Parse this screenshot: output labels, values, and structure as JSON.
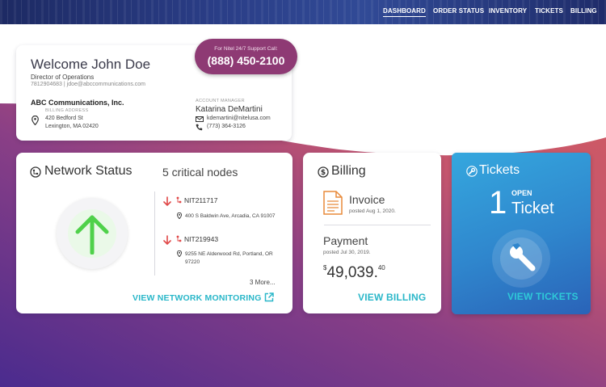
{
  "nav": {
    "items": [
      "DASHBOARD",
      "ORDER STATUS",
      "INVENTORY",
      "TICKETS",
      "BILLING"
    ]
  },
  "welcome": {
    "greeting": "Welcome",
    "name": "John Doe",
    "title": "Director of Operations",
    "contact": "7812904683 | jdoe@abccommunications.com",
    "company": "ABC Communications, Inc.",
    "billing_label": "BILLING ADDRESS",
    "address_line1": "420 Bedford St",
    "address_line2": "Lexington, MA 02420",
    "manager_label": "ACCOUNT MANAGER",
    "manager_name": "Katarina DeMartini",
    "manager_email": "kdemartini@nitelusa.com",
    "manager_phone": "(773) 364-3126"
  },
  "support": {
    "label": "For Nitel 24/7 Support Call:",
    "phone": "(888) 450-2100"
  },
  "network": {
    "title": "Network Status",
    "critical": "5 critical nodes",
    "nodes": [
      {
        "id": "NIT211717",
        "address": "400 S Baldwin Ave, Arcadia, CA 91007"
      },
      {
        "id": "NIT219943",
        "address": "9255 NE Alderwood Rd, Portland, OR 97220"
      }
    ],
    "more": "3 More...",
    "link": "VIEW NETWORK MONITORING"
  },
  "billing": {
    "title": "Billing",
    "invoice_label": "Invoice",
    "invoice_posted": "posted Aug 1, 2020.",
    "payment_label": "Payment",
    "payment_posted": "posted Jul 30, 2019.",
    "amount_currency": "$",
    "amount_main": "49,039.",
    "amount_cents": "40",
    "link": "VIEW BILLING"
  },
  "tickets": {
    "title": "Tickets",
    "count": "1",
    "status": "OPEN",
    "noun": "Ticket",
    "link": "VIEW TICKETS"
  },
  "colors": {
    "accent": "#2ab7c9",
    "support_pill": "#8e3a74",
    "critical": "#e04848",
    "status_ok": "#4fd14a",
    "tickets_grad_top": "#35a7de",
    "tickets_grad_bottom": "#2a63b8"
  },
  "icons": [
    "network-icon",
    "dollar-icon",
    "wrench-icon",
    "arrow-up-icon",
    "arrow-down-icon",
    "pin-icon",
    "phone-icon",
    "mail-icon",
    "invoice-icon",
    "external-link-icon",
    "node-icon"
  ]
}
